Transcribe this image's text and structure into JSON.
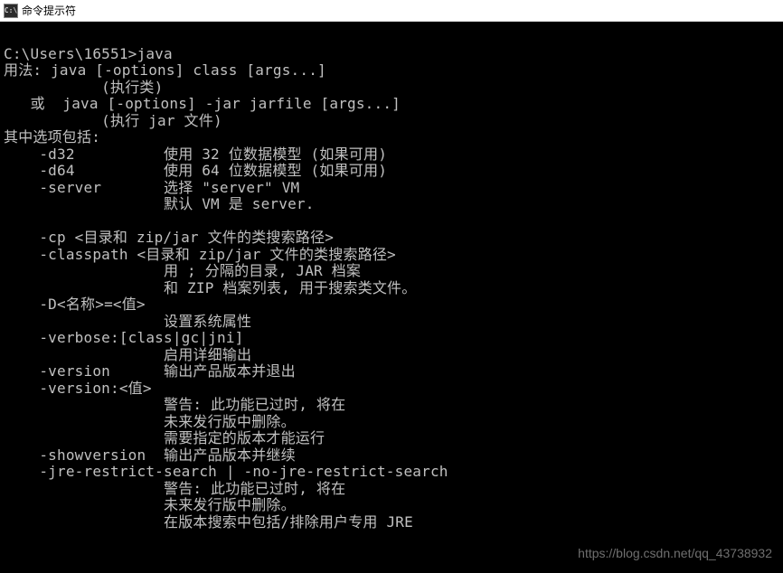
{
  "window": {
    "icon_label": "C:\\",
    "title": "命令提示符"
  },
  "terminal": {
    "prompt": "C:\\Users\\16551>",
    "command": "java",
    "lines": [
      "",
      "C:\\Users\\16551>java",
      "用法: java [-options] class [args...]",
      "           (执行类)",
      "   或  java [-options] -jar jarfile [args...]",
      "           (执行 jar 文件)",
      "其中选项包括:",
      "    -d32          使用 32 位数据模型 (如果可用)",
      "    -d64          使用 64 位数据模型 (如果可用)",
      "    -server       选择 \"server\" VM",
      "                  默认 VM 是 server.",
      "",
      "    -cp <目录和 zip/jar 文件的类搜索路径>",
      "    -classpath <目录和 zip/jar 文件的类搜索路径>",
      "                  用 ; 分隔的目录, JAR 档案",
      "                  和 ZIP 档案列表, 用于搜索类文件。",
      "    -D<名称>=<值>",
      "                  设置系统属性",
      "    -verbose:[class|gc|jni]",
      "                  启用详细输出",
      "    -version      输出产品版本并退出",
      "    -version:<值>",
      "                  警告: 此功能已过时, 将在",
      "                  未来发行版中删除。",
      "                  需要指定的版本才能运行",
      "    -showversion  输出产品版本并继续",
      "    -jre-restrict-search | -no-jre-restrict-search",
      "                  警告: 此功能已过时, 将在",
      "                  未来发行版中删除。",
      "                  在版本搜索中包括/排除用户专用 JRE"
    ]
  },
  "watermark": {
    "text": "https://blog.csdn.net/qq_43738932"
  }
}
